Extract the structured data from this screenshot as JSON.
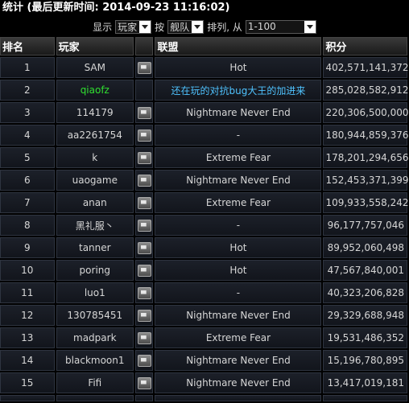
{
  "title": "统计 (最后更新时间: 2014-09-23 11:16:02)",
  "filter": {
    "show_label": "显示",
    "show_value": "玩家",
    "by_label": "按",
    "by_value": "舰队",
    "order_label": "排列, 从",
    "range_value": "1-100"
  },
  "columns": [
    "排名",
    "玩家",
    "",
    "联盟",
    "积分"
  ],
  "rows": [
    {
      "rank": "1",
      "player": "SAM",
      "alliance": "Hot",
      "score": "402,571,141,372"
    },
    {
      "rank": "2",
      "player": "qiaofz",
      "alliance": "还在玩的对抗bug大王的加进来",
      "score": "285,028,582,912"
    },
    {
      "rank": "3",
      "player": "114179",
      "alliance": "Nightmare Never End",
      "score": "220,306,500,000"
    },
    {
      "rank": "4",
      "player": "aa2261754",
      "alliance": "-",
      "score": "180,944,859,376"
    },
    {
      "rank": "5",
      "player": "k",
      "alliance": "Extreme Fear",
      "score": "178,201,294,656"
    },
    {
      "rank": "6",
      "player": "uaogame",
      "alliance": "Nightmare Never End",
      "score": "152,453,371,399"
    },
    {
      "rank": "7",
      "player": "anan",
      "alliance": "Extreme Fear",
      "score": "109,933,558,242"
    },
    {
      "rank": "8",
      "player": "黑礼服丶",
      "alliance": "-",
      "score": "96,177,757,046"
    },
    {
      "rank": "9",
      "player": "tanner",
      "alliance": "Hot",
      "score": "89,952,060,498"
    },
    {
      "rank": "10",
      "player": "poring",
      "alliance": "Hot",
      "score": "47,567,840,001"
    },
    {
      "rank": "11",
      "player": "luo1",
      "alliance": "-",
      "score": "40,323,206,828"
    },
    {
      "rank": "12",
      "player": "130785451",
      "alliance": "Nightmare Never End",
      "score": "29,329,688,948"
    },
    {
      "rank": "13",
      "player": "madpark",
      "alliance": "Extreme Fear",
      "score": "19,531,486,352"
    },
    {
      "rank": "14",
      "player": "blackmoon1",
      "alliance": "Nightmare Never End",
      "score": "15,196,780,895"
    },
    {
      "rank": "15",
      "player": "Fifi",
      "alliance": "Nightmare Never End",
      "score": "13,417,019,181"
    }
  ],
  "colors": {
    "player_highlight": "#30e030",
    "alliance_highlight": "#4fc3ff"
  },
  "icons": {
    "message": "message-icon"
  }
}
